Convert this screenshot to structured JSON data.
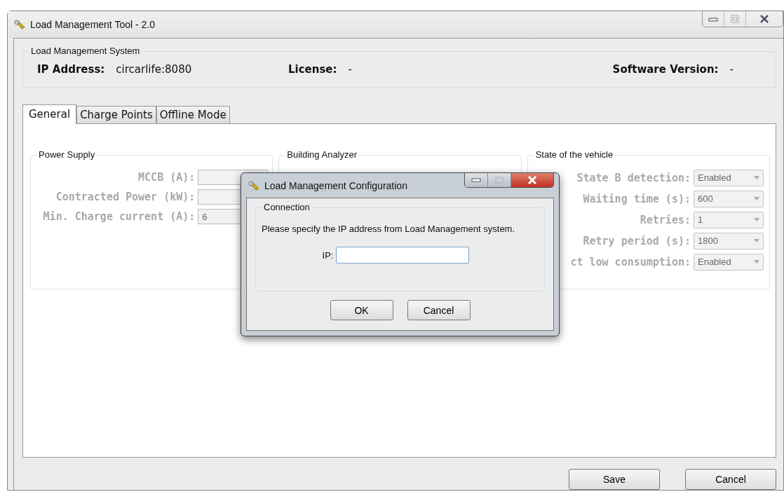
{
  "window": {
    "title": "Load Management Tool - 2.0"
  },
  "system": {
    "legend": "Load Management System",
    "items": [
      {
        "label": "IP Address:",
        "value": "circarlife:8080"
      },
      {
        "label": "License:",
        "value": "-"
      },
      {
        "label": "Software Version:",
        "value": "-"
      }
    ]
  },
  "tabs": [
    {
      "label": "General",
      "selected": true
    },
    {
      "label": "Charge Points",
      "selected": false
    },
    {
      "label": "Offline Mode",
      "selected": false
    }
  ],
  "power_supply": {
    "legend": "Power Supply",
    "disabled": true,
    "fields": [
      {
        "label": "MCCB (A):"
      },
      {
        "label": "Contracted Power (kW):"
      },
      {
        "label": "Min. Charge current (A):",
        "value": "6"
      }
    ]
  },
  "building_analyzer": {
    "legend": "Building Analyzer"
  },
  "vehicle_state": {
    "legend": "State of the vehicle",
    "disabled": true,
    "fields": [
      {
        "label": "State B detection:",
        "value": "Enabled"
      },
      {
        "label": "Waiting time (s):",
        "value": "600"
      },
      {
        "label": "Retries:",
        "value": "1"
      },
      {
        "label": "Retry period (s):",
        "value": "1800"
      },
      {
        "label": "ct low consumption:",
        "value": "Enabled"
      }
    ]
  },
  "buttons": [
    {
      "label": "Save"
    },
    {
      "label": "Cancel"
    }
  ],
  "dialog": {
    "title": "Load Management Configuration",
    "legend": "Connection",
    "message": "Please specify the IP address from Load Management system.",
    "field_label": "IP:",
    "buttons": [
      {
        "label": "OK"
      },
      {
        "label": "Cancel"
      }
    ]
  }
}
